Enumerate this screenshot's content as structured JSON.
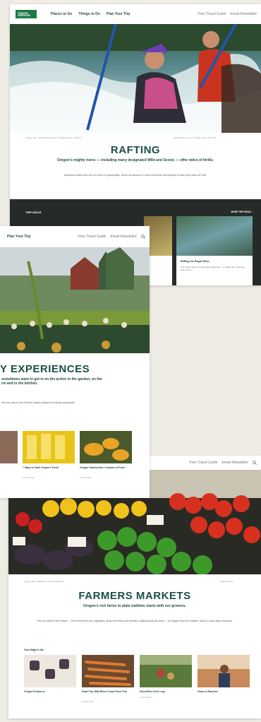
{
  "nav": {
    "logo_text": "TRAVEL OREGON",
    "items": [
      "Places to Go",
      "Things to Do",
      "Plan Your Trip"
    ],
    "utility": [
      "Free Travel Guide",
      "Email Newsletter"
    ]
  },
  "rafting": {
    "breadcrumb": "Oregon Info  ›  Outdoor Recreation  ›  Paddle Sports  ›  Rafting",
    "utility_link": "Add to Places to Go / Things to Do / Plan Trip",
    "title": "RAFTING",
    "subtitle": "Oregon’s mighty rivers — including many designated Wild and Scenic — offer miles of thrills.",
    "body": "Experience water from the river level in a great place, where the season is in and a first timer and beginner to take a trip down the river.",
    "trip_ideas_label": "TRIP IDEAS",
    "more_label": "MORE TRIP IDEAS  →",
    "cards": [
      {
        "title": "Rafting the Rogue River",
        "desc": "The Rogue River is a legendary waterway — a rafting trip is the best way to see it."
      }
    ]
  },
  "culinary": {
    "nav_item": "Plan Your Trip",
    "utility": [
      "Free Travel Guide",
      "Email Newsletter"
    ],
    "title": "Y EXPERIENCES",
    "subtitle": "sometimes want to get in on the action in the garden, on the\nrm and in the kitchen.",
    "body": "Get your step in any of these culinary classes and dining experiences.",
    "cards": [
      {
        "title": "7 Ways to Taste Oregon’s Fresh",
        "sub": "Food & Drink"
      },
      {
        "title": "Oregon Chanterelles: a Season of Food",
        "sub": "Food & Drink"
      }
    ]
  },
  "markets": {
    "nav_utility": [
      "Free Travel Guide",
      "Email Newsletter"
    ],
    "breadcrumb": "Oregon Info  ›  Eat/Drink  ›  Farmers Markets",
    "utility_link": "Add to Places",
    "title": "FARMERS MARKETS",
    "subtitle": "Oregon’s rich farms to plate tradition starts with our growers.",
    "body": "Pick up a taste of the season — from fresh fruits and vegetables, grass-fed meats and cheeses, crafted goods and more — at Oregon’s farmers markets, found in towns large and small.",
    "you_might_like": "You Might Like",
    "cards": [
      {
        "title": "Oregon Producers",
        "sub": ""
      },
      {
        "title": "Road Trip: Wild Rivers Coast Farm Trail",
        "sub": "Food & Drink"
      },
      {
        "title": "Hood River Fruit Loop",
        "sub": "Food & Drink"
      },
      {
        "title": "Farms & Ranches",
        "sub": ""
      }
    ]
  },
  "colors": {
    "brand": "#1d7a46",
    "title": "#1d4e47",
    "dark_band": "#262a29"
  }
}
